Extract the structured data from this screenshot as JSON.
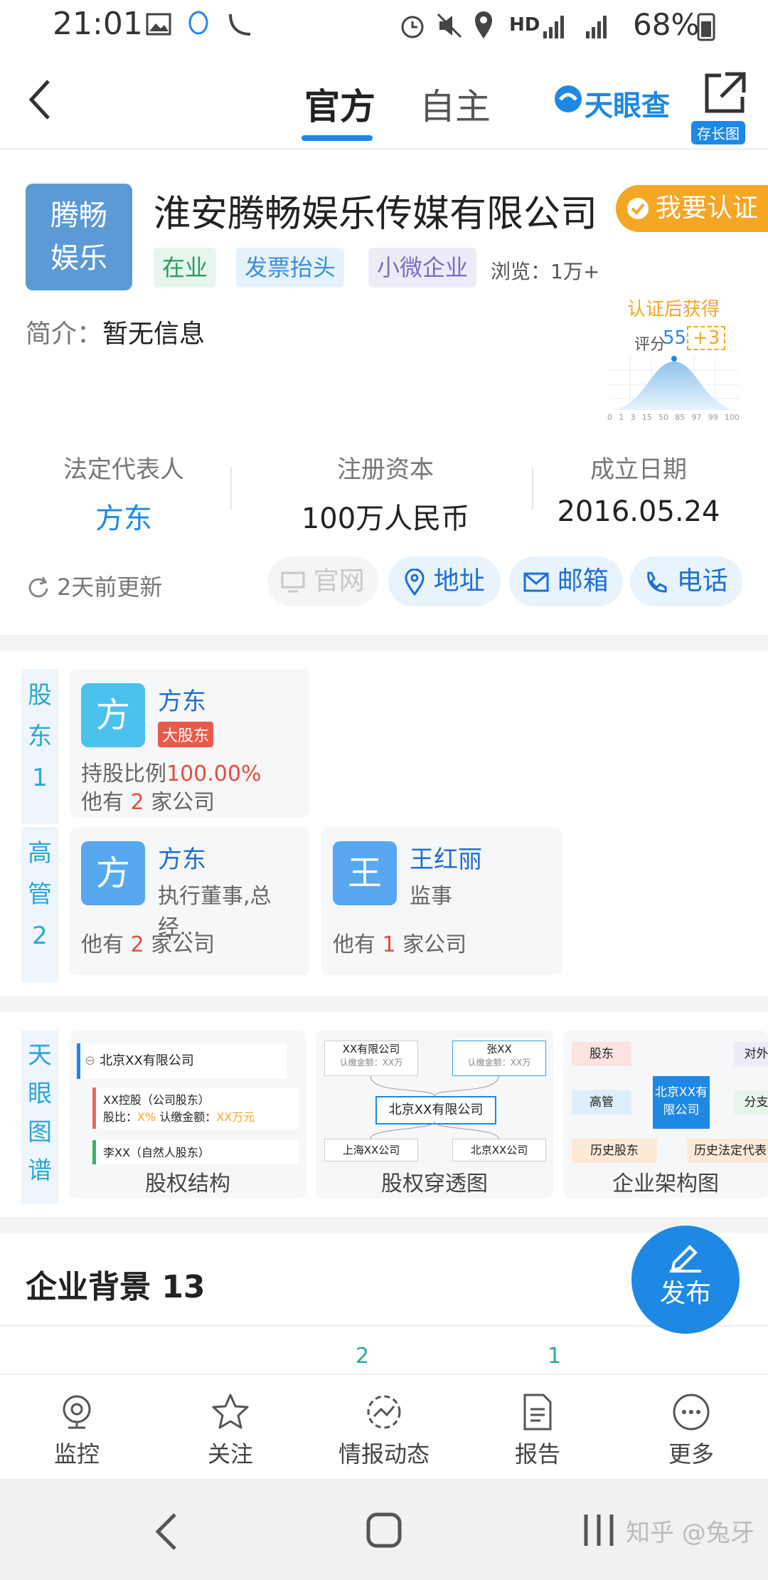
{
  "status_bar": {
    "time": "21:01",
    "network": "HD",
    "battery": "68%"
  },
  "header": {
    "tabs": [
      {
        "label": "官方"
      },
      {
        "label": "自主"
      }
    ],
    "brand": "天眼查",
    "long_image_label": "存长图"
  },
  "company": {
    "logo_text": [
      "腾畅",
      "娱乐"
    ],
    "name": "淮安腾畅娱乐传媒有限公司",
    "cert_button": "我要认证",
    "tags": [
      "在业",
      "发票抬头",
      "小微企业"
    ],
    "views": "浏览：1万+",
    "intro_label": "简介：",
    "intro_value": "暂无信息",
    "score_promo": {
      "title": "认证后获得",
      "score_label": "评分",
      "score": "55",
      "bonus": "+3",
      "axis": [
        "0",
        "1",
        "3",
        "15",
        "50",
        "85",
        "97",
        "99",
        "100"
      ]
    }
  },
  "stats": [
    {
      "label": "法定代表人",
      "value": "方东"
    },
    {
      "label": "注册资本",
      "value": "100万人民币"
    },
    {
      "label": "成立日期",
      "value": "2016.05.24"
    }
  ],
  "contact": {
    "updated": "2天前更新",
    "buttons": [
      {
        "label": "官网"
      },
      {
        "label": "地址"
      },
      {
        "label": "邮箱"
      },
      {
        "label": "电话"
      }
    ]
  },
  "shareholders": {
    "side_label": [
      "股",
      "东",
      "1"
    ],
    "items": [
      {
        "avatar": "方",
        "name": "方东",
        "badge": "大股东",
        "ratio_label": "持股比例",
        "ratio": "100.00%",
        "companies_prefix": "他有",
        "companies_count": "2",
        "companies_suffix": "家公司"
      }
    ]
  },
  "executives": {
    "side_label": [
      "高",
      "管",
      "2"
    ],
    "items": [
      {
        "avatar": "方",
        "name": "方东",
        "role": "执行董事,总经…",
        "companies_prefix": "他有",
        "companies_count": "2",
        "companies_suffix": "家公司"
      },
      {
        "avatar": "王",
        "name": "王红丽",
        "role": "监事",
        "companies_prefix": "他有",
        "companies_count": "1",
        "companies_suffix": "家公司"
      }
    ]
  },
  "graphs": {
    "side_label": [
      "天",
      "眼",
      "图",
      "谱"
    ],
    "items": [
      {
        "label": "股权结构",
        "preview": {
          "root": "北京XX有限公司",
          "child1": "XX控股（公司股东）",
          "child1_ratio": "股比：",
          "child1_ratio_val": "X%",
          "child1_capital": "认缴金额：",
          "child1_capital_val": "XX万元",
          "child2": "李XX（自然人股东）"
        }
      },
      {
        "label": "股权穿透图",
        "preview": {
          "top_left": "XX有限公司",
          "top_left_sub": "认缴金额：XX万",
          "top_right": "张XX",
          "top_right_sub": "认缴金额：XX万",
          "center": "北京XX有限公司",
          "bottom_left": "上海XX公司",
          "bottom_right": "北京XX公司"
        }
      },
      {
        "label": "企业架构图",
        "preview": {
          "a": "股东",
          "b": "高管",
          "c": "历史股东",
          "center": "北京XX有限公司",
          "d": "对外投",
          "e": "分支机",
          "f": "历史法定代表"
        }
      }
    ]
  },
  "background": {
    "title": "企业背景 13",
    "counts": [
      "2",
      "1"
    ]
  },
  "fab": {
    "label": "发布"
  },
  "bottom_nav": [
    {
      "label": "监控"
    },
    {
      "label": "关注"
    },
    {
      "label": "情报动态"
    },
    {
      "label": "报告"
    },
    {
      "label": "更多"
    }
  ],
  "watermark": "知乎 @兔牙",
  "colors": {
    "accent": "#1e88e5",
    "orange": "#f5a623",
    "red": "#e64c3c"
  }
}
